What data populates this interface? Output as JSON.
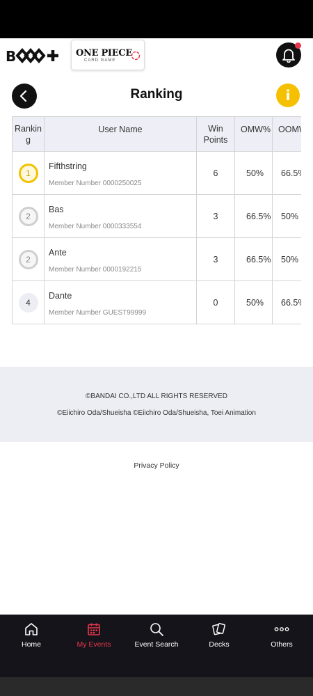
{
  "header": {
    "app_logo_text": "B+",
    "game_logo_main": "ONE PIECE",
    "game_logo_sub": "CARD GAME"
  },
  "page": {
    "title": "Ranking",
    "info_label": "i"
  },
  "table": {
    "headers": {
      "rank": "Ranking",
      "user_name": "User Name",
      "win_points": "Win Points",
      "omw": "OMW%",
      "oomw": "OOMW%"
    },
    "rows": [
      {
        "rank": "1",
        "name": "Fifthstring",
        "member": "Member Number 0000250025",
        "win_points": "6",
        "omw": "50%",
        "oomw": "66.5%"
      },
      {
        "rank": "2",
        "name": "Bas",
        "member": "Member Number 0000333554",
        "win_points": "3",
        "omw": "66.5%",
        "oomw": "50%"
      },
      {
        "rank": "2",
        "name": "Ante",
        "member": "Member Number 0000192215",
        "win_points": "3",
        "omw": "66.5%",
        "oomw": "50%"
      },
      {
        "rank": "4",
        "name": "Dante",
        "member": "Member Number GUEST99999",
        "win_points": "0",
        "omw": "50%",
        "oomw": "66.5%"
      }
    ]
  },
  "footer": {
    "copyright_1": "©BANDAI CO.,LTD ALL RIGHTS RESERVED",
    "copyright_2": "©Eiichiro Oda/Shueisha ©Eiichiro Oda/Shueisha, Toei Animation",
    "privacy": "Privacy Policy"
  },
  "nav": {
    "items": [
      {
        "label": "Home",
        "icon": "home-icon"
      },
      {
        "label": "My Events",
        "icon": "calendar-icon",
        "active": true
      },
      {
        "label": "Event Search",
        "icon": "search-icon"
      },
      {
        "label": "Decks",
        "icon": "cards-icon"
      },
      {
        "label": "Others",
        "icon": "more-icon"
      }
    ]
  },
  "colors": {
    "accent": "#e8364d",
    "gold": "#f2c200",
    "info": "#f5c000",
    "nav_bg": "#14141a",
    "header_cell_bg": "#eeeef6"
  }
}
